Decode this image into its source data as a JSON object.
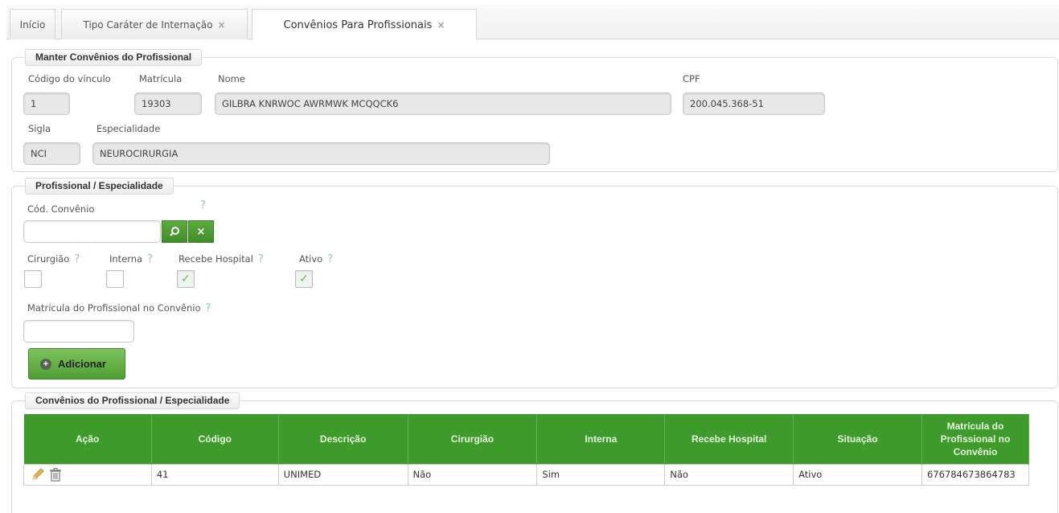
{
  "tabs": [
    {
      "label": "Início",
      "closable": false
    },
    {
      "label": "Tipo Caráter de Internação",
      "closable": true
    },
    {
      "label": "Convênios Para Profissionais",
      "closable": true,
      "active": true
    }
  ],
  "close_glyph": "×",
  "help_glyph": "?",
  "manter": {
    "legend": "Manter Convênios do Profissional",
    "codigo_label": "Código do vínculo",
    "codigo_value": "1",
    "matricula_label": "Matrícula",
    "matricula_value": "19303",
    "nome_label": "Nome",
    "nome_value": "GILBRA KNRWOC AWRMWK MCQQCK6",
    "cpf_label": "CPF",
    "cpf_value": "200.045.368-51",
    "sigla_label": "Sigla",
    "sigla_value": "NCI",
    "especialidade_label": "Especialidade",
    "especialidade_value": "NEUROCIRURGIA"
  },
  "profissional": {
    "legend": "Profissional / Especialidade",
    "cod_convenio_label": "Cód. Convênio",
    "cod_convenio_value": "",
    "checkboxes": [
      {
        "label": "Cirurgião",
        "checked": false
      },
      {
        "label": "Interna",
        "checked": false
      },
      {
        "label": "Recebe Hospital",
        "checked": true
      },
      {
        "label": "Ativo",
        "checked": true
      }
    ],
    "matricula_label": "Matrícula do Profissional no Convênio",
    "matricula_value": "",
    "add_label": "Adicionar"
  },
  "convenios": {
    "legend": "Convênios do Profissional / Especialidade",
    "columns": [
      "Ação",
      "Código",
      "Descrição",
      "Cirurgião",
      "Interna",
      "Recebe Hospital",
      "Situação",
      "Matrícula do Profissional no Convênio"
    ],
    "rows": [
      {
        "codigo": "41",
        "descricao": "UNIMED",
        "cirurgiao": "Não",
        "interna": "Sim",
        "recebe": "Não",
        "situacao": "Ativo",
        "matricula": "676784673864783"
      }
    ]
  },
  "colors": {
    "accent_green": "#3e9a2b",
    "help": "#8dc1cc"
  }
}
